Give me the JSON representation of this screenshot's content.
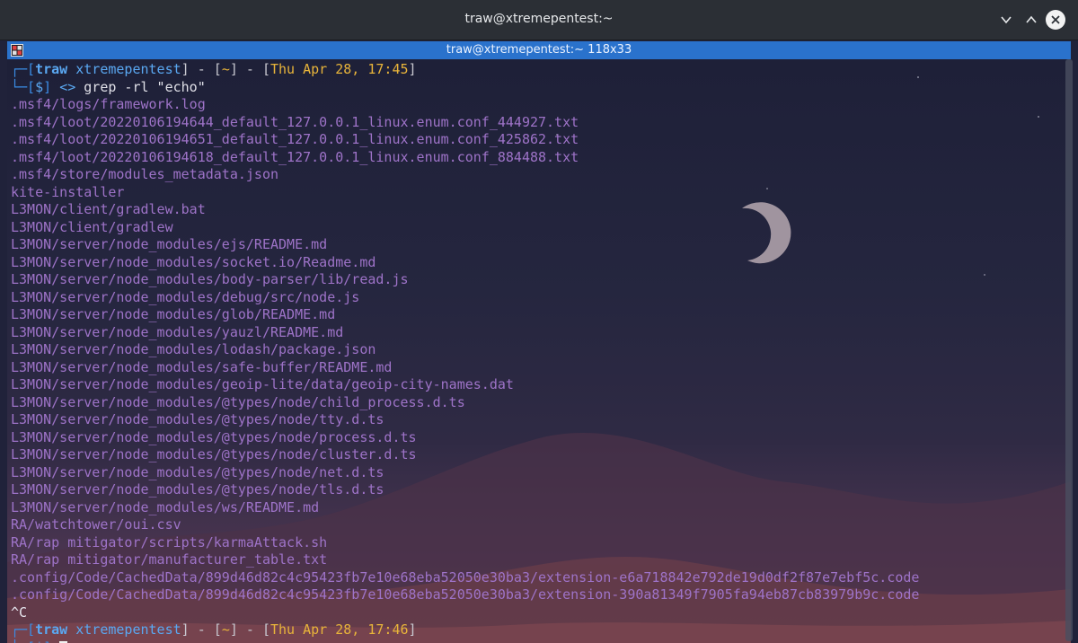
{
  "window": {
    "title": "traw@xtremepentest:~"
  },
  "tab": {
    "title": "traw@xtremepentest:~ 118x33"
  },
  "prompt1": {
    "open": "┌─[",
    "user": "traw",
    "host": "xtremepentest",
    "mid1": "] - [",
    "dir": "~",
    "mid2": "] - [",
    "date": "Thu Apr 28, 17:45",
    "close": "]"
  },
  "prompt1b": {
    "open": "└─[",
    "dollar": "$",
    "close": "]",
    "arrow": "<>",
    "command": "grep -rl \"echo\""
  },
  "output": [
    ".msf4/logs/framework.log",
    ".msf4/loot/20220106194644_default_127.0.0.1_linux.enum.conf_444927.txt",
    ".msf4/loot/20220106194651_default_127.0.0.1_linux.enum.conf_425862.txt",
    ".msf4/loot/20220106194618_default_127.0.0.1_linux.enum.conf_884488.txt",
    ".msf4/store/modules_metadata.json",
    "kite-installer",
    "L3MON/client/gradlew.bat",
    "L3MON/client/gradlew",
    "L3MON/server/node_modules/ejs/README.md",
    "L3MON/server/node_modules/socket.io/Readme.md",
    "L3MON/server/node_modules/body-parser/lib/read.js",
    "L3MON/server/node_modules/debug/src/node.js",
    "L3MON/server/node_modules/glob/README.md",
    "L3MON/server/node_modules/yauzl/README.md",
    "L3MON/server/node_modules/lodash/package.json",
    "L3MON/server/node_modules/safe-buffer/README.md",
    "L3MON/server/node_modules/geoip-lite/data/geoip-city-names.dat",
    "L3MON/server/node_modules/@types/node/child_process.d.ts",
    "L3MON/server/node_modules/@types/node/tty.d.ts",
    "L3MON/server/node_modules/@types/node/process.d.ts",
    "L3MON/server/node_modules/@types/node/cluster.d.ts",
    "L3MON/server/node_modules/@types/node/net.d.ts",
    "L3MON/server/node_modules/@types/node/tls.d.ts",
    "L3MON/server/node_modules/ws/README.md",
    "RA/watchtower/oui.csv",
    "RA/rap mitigator/scripts/karmaAttack.sh",
    "RA/rap mitigator/manufacturer_table.txt",
    ".config/Code/CachedData/899d46d82c4c95423fb7e10e68eba52050e30ba3/extension-e6a718842e792de19d0df2f87e7ebf5c.code",
    ".config/Code/CachedData/899d46d82c4c95423fb7e10e68eba52050e30ba3/extension-390a81349f7905fa94eb87cb83979b9c.code"
  ],
  "interrupt": "^C",
  "prompt2": {
    "open": "┌─[",
    "user": "traw",
    "host": "xtremepentest",
    "mid1": "] - [",
    "dir": "~",
    "mid2": "] - [",
    "date": "Thu Apr 28, 17:46",
    "close": "]"
  },
  "prompt2b": {
    "open": "└─[",
    "dollar": "$",
    "close": "]"
  },
  "icons": {
    "minimize": "chevron-down-icon",
    "maximize": "chevron-up-icon",
    "close": "close-icon",
    "tab": "terminal-tab-icon"
  },
  "colors": {
    "tabbar": "#2a72cc",
    "output_text": "#9e73c8",
    "prompt_blue": "#5aa8f2",
    "date_yellow": "#e8b43a"
  }
}
